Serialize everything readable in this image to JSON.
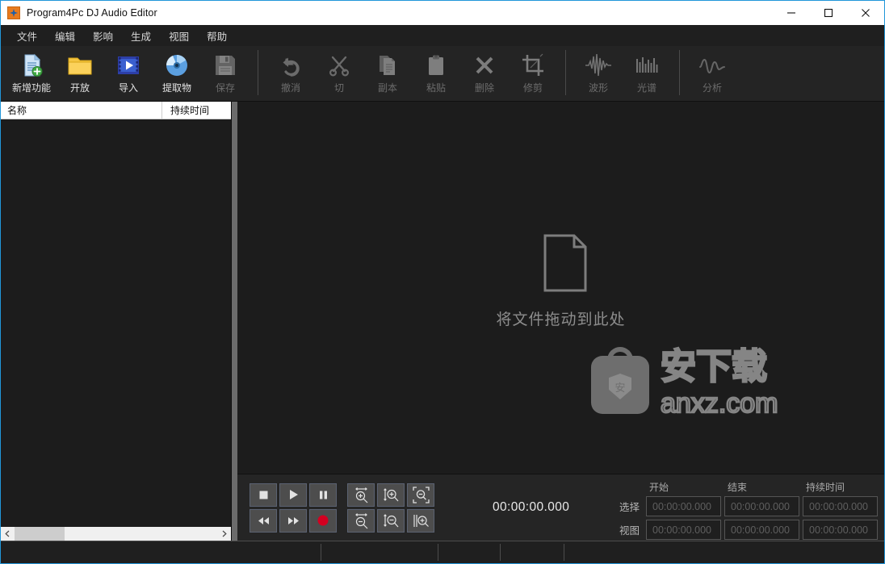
{
  "window": {
    "title": "Program4Pc DJ Audio Editor",
    "app_icon": "app-logo-icon",
    "minimize_label": "—",
    "maximize_label": "□",
    "close_label": "✕",
    "accent_color": "#2196d9"
  },
  "menubar": {
    "items": [
      {
        "label": "文件"
      },
      {
        "label": "编辑"
      },
      {
        "label": "影响"
      },
      {
        "label": "生成"
      },
      {
        "label": "视图"
      },
      {
        "label": "帮助"
      }
    ]
  },
  "toolbar": {
    "groups": [
      {
        "name": "file-group",
        "buttons": [
          {
            "label": "新增功能",
            "icon": "new-document-icon",
            "enabled": true
          },
          {
            "label": "开放",
            "icon": "open-folder-icon",
            "enabled": true
          },
          {
            "label": "导入",
            "icon": "import-film-icon",
            "enabled": true
          },
          {
            "label": "提取物",
            "icon": "extract-cd-icon",
            "enabled": true
          },
          {
            "label": "保存",
            "icon": "save-floppy-icon",
            "enabled": false
          }
        ]
      },
      {
        "name": "edit-group",
        "buttons": [
          {
            "label": "撤消",
            "icon": "undo-arrow-icon",
            "enabled": false
          },
          {
            "label": "切",
            "icon": "cut-scissors-icon",
            "enabled": false
          },
          {
            "label": "副本",
            "icon": "copy-pages-icon",
            "enabled": false
          },
          {
            "label": "粘贴",
            "icon": "paste-clipboard-icon",
            "enabled": false
          },
          {
            "label": "删除",
            "icon": "delete-cross-icon",
            "enabled": false
          },
          {
            "label": "修剪",
            "icon": "trim-crop-icon",
            "enabled": false
          }
        ]
      },
      {
        "name": "view-group",
        "buttons": [
          {
            "label": "波形",
            "icon": "waveform-icon",
            "enabled": false
          },
          {
            "label": "光谱",
            "icon": "spectrum-icon",
            "enabled": false
          }
        ]
      },
      {
        "name": "analyze-group",
        "buttons": [
          {
            "label": "分析",
            "icon": "analyze-wave-icon",
            "enabled": false
          }
        ]
      }
    ]
  },
  "filelist": {
    "columns": [
      {
        "label": "名称"
      },
      {
        "label": "持续时间"
      }
    ],
    "rows": [],
    "scroll_left_icon": "chevron-left-icon",
    "scroll_right_icon": "chevron-right-icon"
  },
  "dropzone": {
    "icon": "document-page-icon",
    "message": "将文件拖动到此处",
    "watermark": {
      "badge_char": "安",
      "cn_text": "安下载",
      "url_text": "anxz.com"
    }
  },
  "transport": {
    "buttons": [
      {
        "name": "stop-button",
        "icon": "stop-icon"
      },
      {
        "name": "play-button",
        "icon": "play-icon"
      },
      {
        "name": "pause-button",
        "icon": "pause-icon"
      },
      {
        "name": "rewind-button",
        "icon": "rewind-icon"
      },
      {
        "name": "forward-button",
        "icon": "fast-forward-icon"
      },
      {
        "name": "record-button",
        "icon": "record-icon",
        "color": "#d40020"
      }
    ],
    "zoom_buttons": [
      {
        "name": "zoom-in-horizontal-button",
        "icon": "zoom-in-horizontal-icon"
      },
      {
        "name": "zoom-in-vertical-button",
        "icon": "zoom-in-vertical-icon"
      },
      {
        "name": "zoom-to-fit-button",
        "icon": "zoom-fit-icon"
      },
      {
        "name": "zoom-out-horizontal-button",
        "icon": "zoom-out-horizontal-icon"
      },
      {
        "name": "zoom-out-vertical-button",
        "icon": "zoom-out-vertical-icon"
      },
      {
        "name": "zoom-selection-button",
        "icon": "zoom-selection-icon"
      }
    ],
    "timecode": "00:00:00.000",
    "timecode_color": "#e9e9e9"
  },
  "timefields": {
    "col_headers": [
      "开始",
      "结束",
      "持续时间"
    ],
    "rows": [
      {
        "label": "选择",
        "values": [
          "00:00:00.000",
          "00:00:00.000",
          "00:00:00.000"
        ]
      },
      {
        "label": "视图",
        "values": [
          "00:00:00.000",
          "00:00:00.000",
          "00:00:00.000"
        ]
      }
    ]
  },
  "statusbar": {
    "cells": [
      "",
      "",
      "",
      "",
      ""
    ]
  }
}
